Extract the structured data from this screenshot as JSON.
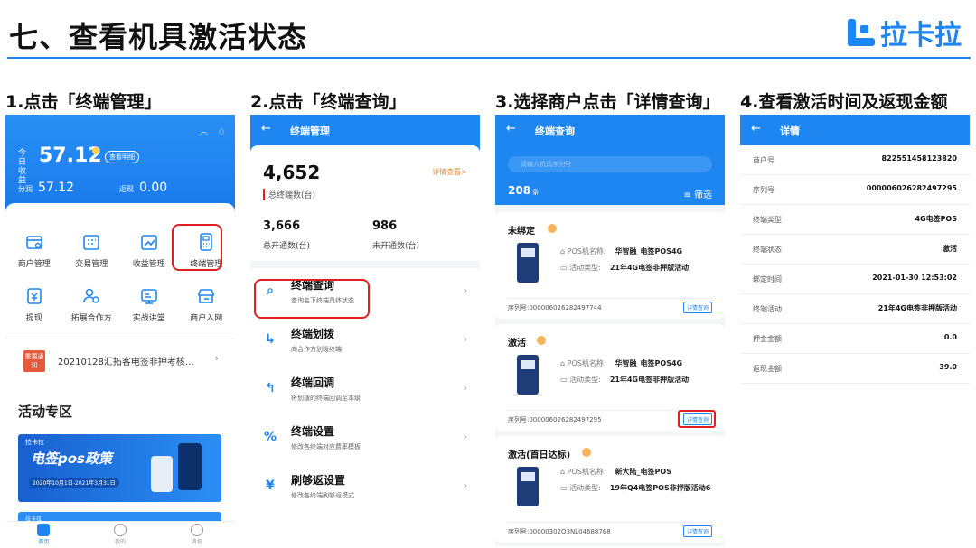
{
  "slide": {
    "title": "七、查看机具激活状态",
    "logo_text": "拉卡拉"
  },
  "steps": [
    "1.点击「终端管理」",
    "2.点击「终端查询」",
    "3.选择商户点击「详情查询」",
    "4.查看激活时间及返现金额"
  ],
  "phone1": {
    "today_label": "今日收益",
    "today_value": "57.12",
    "detail_button": "查看明细",
    "split_label": "分润",
    "split_value": "57.12",
    "cashback_label": "返现",
    "cashback_value": "0.00",
    "grid": [
      {
        "label": "商户管理",
        "icon": "merchant-icon"
      },
      {
        "label": "交易管理",
        "icon": "transaction-icon"
      },
      {
        "label": "收益管理",
        "icon": "income-icon"
      },
      {
        "label": "终端管理",
        "icon": "terminal-icon"
      },
      {
        "label": "提现",
        "icon": "withdraw-icon"
      },
      {
        "label": "拓展合作方",
        "icon": "partner-icon"
      },
      {
        "label": "实战讲堂",
        "icon": "lecture-icon"
      },
      {
        "label": "商户入网",
        "icon": "onboard-icon"
      }
    ],
    "notice_badge": "重要通知",
    "notice_text": "20210128汇拓客电签非押考核…",
    "zone_title": "活动专区",
    "banner_logo": "拉卡拉",
    "banner_title": "电签pos政策",
    "banner_date": "2020年10月1日-2021年3月31日",
    "banner2_logo": "拉卡拉",
    "tabs": [
      "首页",
      "我的",
      "消息"
    ]
  },
  "phone2": {
    "header_title": "终端管理",
    "total_value": "4,652",
    "total_label": "总终端数(台)",
    "more_link": "详情查看>",
    "activated_value": "3,666",
    "activated_label": "总开通数(台)",
    "inactive_value": "986",
    "inactive_label": "未开通数(台)",
    "menu": [
      {
        "title": "终端查询",
        "desc": "查询名下终端具体状态",
        "icon": "search-icon"
      },
      {
        "title": "终端划拨",
        "desc": "向合作方划拨终端",
        "icon": "transfer-icon"
      },
      {
        "title": "终端回调",
        "desc": "将划拨的终端回调至本级",
        "icon": "return-icon"
      },
      {
        "title": "终端设置",
        "desc": "修改各终端对应费率模板",
        "icon": "percent-icon"
      },
      {
        "title": "刷够返设置",
        "desc": "修改各终端刷够返模式",
        "icon": "cashback-icon"
      }
    ]
  },
  "phone3": {
    "header_title": "终端查询",
    "search_placeholder": "请输入机具序列号",
    "count_value": "208",
    "count_unit": "条",
    "filter_label": "筛选",
    "name_label": "POS机名称:",
    "type_label": "活动类型:",
    "detail_button": "详情查询",
    "items": [
      {
        "status": "未绑定",
        "name": "华智融_电签POS4G",
        "type": "21年4G电签非押版活动",
        "serial": "序列号:000006026282497744"
      },
      {
        "status": "激活",
        "name": "华智融_电签POS4G",
        "type": "21年4G电签非押版活动",
        "serial": "序列号:000006026282497295"
      },
      {
        "status": "激活(首日达标)",
        "name": "新大陆_电签POS",
        "type": "19年Q4电签POS非押版活动6",
        "serial": "序列号:00000302Q3NL04688768"
      }
    ]
  },
  "phone4": {
    "header_title": "详情",
    "rows": [
      {
        "key": "商户号",
        "value": "822551458123820"
      },
      {
        "key": "序列号",
        "value": "000006026282497295"
      },
      {
        "key": "终端类型",
        "value": "4G电签POS"
      },
      {
        "key": "终端状态",
        "value": "激活"
      },
      {
        "key": "绑定时间",
        "value": "2021-01-30 12:53:02"
      },
      {
        "key": "终端活动",
        "value": "21年4G电签非押版活动"
      },
      {
        "key": "押金金额",
        "value": "0.0"
      },
      {
        "key": "返现金额",
        "value": "39.0"
      }
    ]
  },
  "colors": {
    "brand": "#1e86f0",
    "highlight": "#e02020"
  }
}
